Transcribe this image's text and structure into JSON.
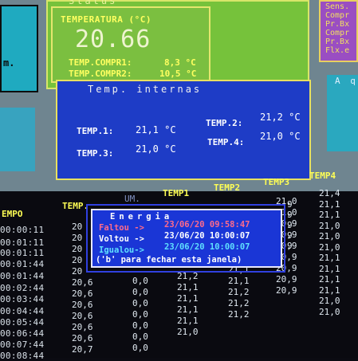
{
  "status_panel": {
    "title": "Status",
    "temperatura_label": "TEMPERATURA (°C)",
    "temperatura_value": "20.66",
    "compr1_label": "TEMP.COMPR1:",
    "compr1_value": "8,3 °C",
    "compr2_label": "TEMP.COMPR2:",
    "compr2_value": "10,5 °C"
  },
  "left_panel": {
    "text": "m."
  },
  "right_panel": {
    "lines": [
      "Sens.",
      "Compr",
      "Pr.Bx",
      "Compr",
      "Pr.Bx",
      "Flx.e"
    ]
  },
  "right_cyan_panel": {
    "text": "A q"
  },
  "internas_panel": {
    "title": "Temp. internas",
    "t1_label": "TEMP.1:",
    "t1_value": "21,1 °C",
    "t2_label": "TEMP.2:",
    "t2_value": "21,2 °C",
    "t3_label": "TEMP.3:",
    "t3_value": "21,0 °C",
    "t4_label": "TEMP.4:",
    "t4_value": "21,0 °C"
  },
  "table": {
    "headers": [
      "EMPO",
      "TEMP.",
      "UM.",
      "TEMP1",
      "TEMP2",
      "TEMP3",
      "TEMP4"
    ],
    "times": [
      "00:00:11",
      "00:01:11",
      "00:01:11",
      "00:01:44",
      "00:01:44",
      "00:02:44",
      "00:03:44",
      "00:04:44",
      "00:05:44",
      "00:06:44",
      "00:07:44",
      "00:08:44"
    ],
    "temp_col": [
      "20",
      "20",
      "20",
      "20",
      "20",
      "20,6",
      "20,6",
      "20,6",
      "20,6",
      "20,6",
      "20,6",
      "20,7"
    ],
    "um_col": [
      "",
      "",
      "",
      "",
      "",
      "0,0",
      "0,0",
      "0,0",
      "0,0",
      "0,0",
      "0,0",
      "0,0"
    ],
    "temp1_col": [
      "",
      "",
      "",
      "",
      "",
      "21,2",
      "21,1",
      "21,1",
      "21,1",
      "21,1",
      "21,0",
      ""
    ],
    "temp2_col": [
      "",
      "",
      "",
      "",
      "21,2",
      "21,1",
      "21,1",
      "21,2",
      "21,2",
      "21,2",
      "",
      ""
    ],
    "temp3_col": [
      "21,0",
      "21,0",
      "20,9",
      "20,9",
      "20,9",
      "20,9",
      "20,9",
      "20,9",
      "20,9",
      "",
      "",
      ""
    ],
    "temp4_col": [
      "21,4",
      "21,1",
      "21,1",
      "21,0",
      "21,0",
      "21,0",
      "21,1",
      "21,1",
      "21,1",
      "21,1",
      "21,0",
      "21,0"
    ],
    "temp3_top": [
      "9",
      "9",
      "9",
      "9",
      "9"
    ]
  },
  "energia_popup": {
    "title": "Energia",
    "line1_label": "Faltou ->",
    "line1_value": "23/06/20 09:58:47",
    "line2_label": "Voltou ->",
    "line2_value": "23/06/20 10:00:07",
    "line3_label": "Igualou->",
    "line3_value": "23/06/20 10:00:07",
    "footer": "('b' para fechar esta janela)"
  },
  "colors": {
    "status_green": "#76c23b",
    "internas_blue": "#1e3cc6",
    "popup_blue": "#1a36d6",
    "header_yellow": "#ffff55",
    "faltou_red": "#ff6b8a",
    "cyan": "#2aa8bf"
  }
}
